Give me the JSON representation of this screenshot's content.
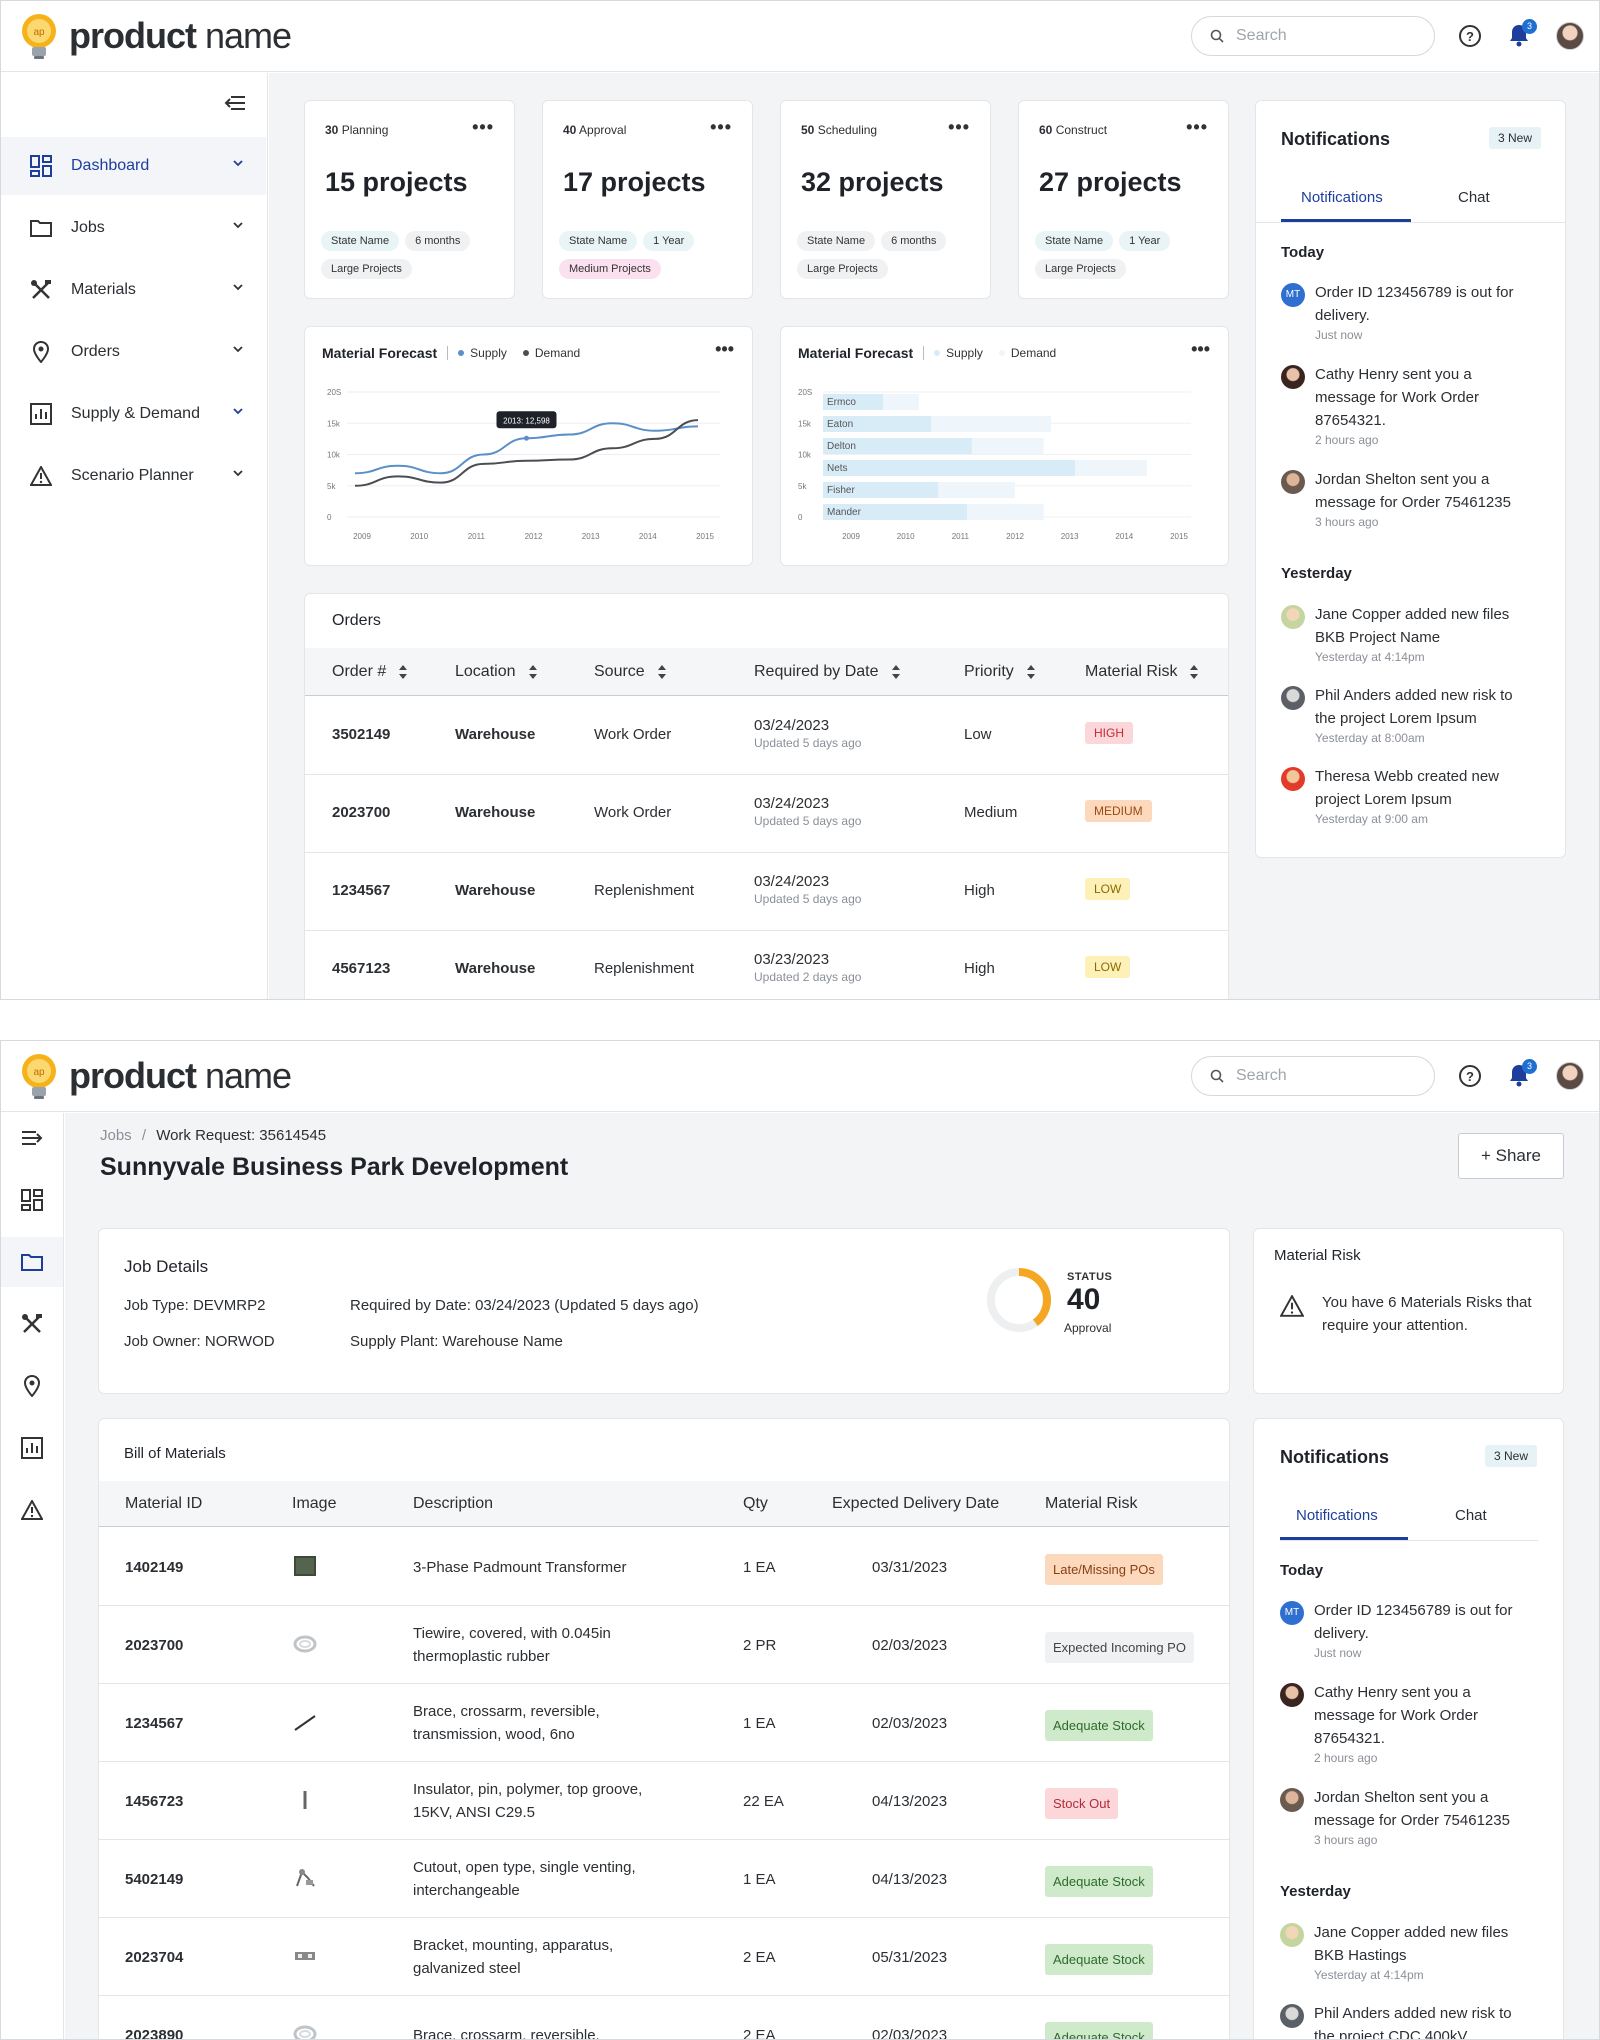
{
  "app": {
    "logo_bold": "product",
    "logo_rest": "name",
    "search_placeholder": "Search",
    "notification_count": "3"
  },
  "sidebar": {
    "items": [
      {
        "label": "Dashboard",
        "icon": "dashboard-icon"
      },
      {
        "label": "Jobs",
        "icon": "folder-icon"
      },
      {
        "label": "Materials",
        "icon": "tools-icon"
      },
      {
        "label": "Orders",
        "icon": "location-pin-icon"
      },
      {
        "label": "Supply & Demand",
        "icon": "bar-chart-icon"
      },
      {
        "label": "Scenario Planner",
        "icon": "warning-icon"
      }
    ]
  },
  "stats": [
    {
      "count": "30",
      "stage": "Planning",
      "projects": "15 projects",
      "tags": [
        "State Name",
        "6 months",
        "Large Projects"
      ]
    },
    {
      "count": "40",
      "stage": "Approval",
      "projects": "17 projects",
      "tags": [
        "State Name",
        "1 Year",
        "Medium Projects"
      ]
    },
    {
      "count": "50",
      "stage": "Scheduling",
      "projects": "32 projects",
      "tags": [
        "State Name",
        "6 months",
        "Large Projects"
      ]
    },
    {
      "count": "60",
      "stage": "Construct",
      "projects": "27 projects",
      "tags": [
        "State Name",
        "1 Year",
        "Large Projects"
      ]
    }
  ],
  "forecast_line": {
    "title": "Material Forecast",
    "legend_supply": "Supply",
    "legend_demand": "Demand",
    "tooltip": "2013: 12,598"
  },
  "forecast_bar": {
    "title": "Material Forecast",
    "legend_supply": "Supply",
    "legend_demand": "Demand"
  },
  "chart_data": [
    {
      "type": "line",
      "title": "Material Forecast",
      "x": [
        "2009",
        "2010",
        "2011",
        "2012",
        "2013",
        "2014",
        "2015"
      ],
      "ytick_labels": [
        "0",
        "5k",
        "10k",
        "15k",
        "20S"
      ],
      "ylim": [
        0,
        20000
      ],
      "series": [
        {
          "name": "Supply",
          "color": "#5b8fc7",
          "values": [
            7000,
            8200,
            7000,
            10000,
            12598,
            13200,
            15000,
            13800,
            14500
          ]
        },
        {
          "name": "Demand",
          "color": "#4a4d52",
          "values": [
            5000,
            6500,
            5500,
            8500,
            9000,
            9200,
            11000,
            12500,
            15500
          ]
        }
      ],
      "grid": true,
      "legend": "top"
    },
    {
      "type": "bar",
      "title": "Material Forecast",
      "x": [
        "2009",
        "2010",
        "2011",
        "2012",
        "2013",
        "2014",
        "2015"
      ],
      "ytick_labels": [
        "0",
        "5k",
        "10k",
        "15k",
        "20S"
      ],
      "categories": [
        "Ermco",
        "Eaton",
        "Delton",
        "Nets",
        "Fisher",
        "Mander"
      ],
      "series": [
        {
          "name": "Supply",
          "color": "#d7ecf7",
          "values": [
            2500,
            4500,
            6200,
            10500,
            4800,
            6000
          ]
        },
        {
          "name": "Demand",
          "color": "#eef6fb",
          "values": [
            4000,
            9500,
            9200,
            13500,
            8000,
            9200
          ]
        }
      ],
      "xlim": [
        0,
        14500
      ],
      "grid": true,
      "legend": "top"
    }
  ],
  "orders": {
    "title": "Orders",
    "columns": [
      "Order #",
      "Location",
      "Source",
      "Required by Date",
      "Priority",
      "Material Risk"
    ],
    "rows": [
      {
        "order": "3502149",
        "location": "Warehouse",
        "source": "Work Order",
        "date": "03/24/2023",
        "updated": "Updated 5 days ago",
        "priority": "Low",
        "risk": "HIGH",
        "risk_level": "high"
      },
      {
        "order": "2023700",
        "location": "Warehouse",
        "source": "Work Order",
        "date": "03/24/2023",
        "updated": "Updated 5 days ago",
        "priority": "Medium",
        "risk": "MEDIUM",
        "risk_level": "medium"
      },
      {
        "order": "1234567",
        "location": "Warehouse",
        "source": "Replenishment",
        "date": "03/24/2023",
        "updated": "Updated 5 days ago",
        "priority": "High",
        "risk": "LOW",
        "risk_level": "low"
      },
      {
        "order": "4567123",
        "location": "Warehouse",
        "source": "Replenishment",
        "date": "03/23/2023",
        "updated": "Updated 2 days ago",
        "priority": "High",
        "risk": "LOW",
        "risk_level": "low"
      }
    ]
  },
  "notifications": {
    "title": "Notifications",
    "new_badge": "3 New",
    "tab_notifications": "Notifications",
    "tab_chat": "Chat",
    "today": "Today",
    "yesterday": "Yesterday",
    "items_today": [
      {
        "avatar": "MT",
        "text": "Order ID 123456789 is out for delivery.",
        "time": "Just now"
      },
      {
        "avatar": "",
        "text": "Cathy Henry sent you a message for Work Order 87654321.",
        "time": "2 hours ago"
      },
      {
        "avatar": "",
        "text": "Jordan Shelton sent you a message for Order 75461235",
        "time": "3 hours ago"
      }
    ],
    "items_yesterday": [
      {
        "text": "Jane Copper added new files BKB Project Name",
        "time": "Yesterday at 4:14pm"
      },
      {
        "text": "Phil Anders added new risk to the project Lorem Ipsum",
        "time": "Yesterday at 8:00am"
      },
      {
        "text": "Theresa Webb created new project Lorem Ipsum",
        "time": "Yesterday at 9:00 am"
      }
    ]
  },
  "job": {
    "breadcrumb_root": "Jobs",
    "breadcrumb_sep": "/",
    "breadcrumb_current": "Work Request: 35614545",
    "title": "Sunnyvale Business Park Development",
    "share_label": "+ Share",
    "details_title": "Job Details",
    "job_type_label": "Job Type:",
    "job_type": "DEVMRP2",
    "job_owner_label": "Job Owner:",
    "job_owner": "NORWOD",
    "required_by": "Required by Date: 03/24/2023 (Updated 5 days ago)",
    "supply_plant": "Supply Plant: Warehouse Name",
    "status_label": "STATUS",
    "status_value": "40",
    "status_stage": "Approval",
    "status_progress": 0.4
  },
  "material_risk": {
    "title": "Material Risk",
    "text": "You have 6 Materials Risks that require your attention."
  },
  "bom": {
    "title": "Bill of Materials",
    "columns": [
      "Material ID",
      "Image",
      "Description",
      "Qty",
      "Expected Delivery Date",
      "Material Risk"
    ],
    "rows": [
      {
        "id": "1402149",
        "desc": "3-Phase Padmount Transformer",
        "qty": "1 EA",
        "date": "03/31/2023",
        "risk": "Late/Missing POs",
        "risk_level": "late",
        "img": "transformer-image"
      },
      {
        "id": "2023700",
        "desc": "Tiewire, covered, with 0.045in thermoplastic rubber",
        "qty": "2 PR",
        "date": "02/03/2023",
        "risk": "Expected Incoming PO",
        "risk_level": "exp",
        "img": "tiewire-image"
      },
      {
        "id": "1234567",
        "desc": "Brace, crossarm, reversible, transmission, wood, 6no",
        "qty": "1 EA",
        "date": "02/03/2023",
        "risk": "Adequate Stock",
        "risk_level": "ok",
        "img": "brace-image"
      },
      {
        "id": "1456723",
        "desc": "Insulator, pin, polymer, top groove, 15KV, ANSI C29.5",
        "qty": "22 EA",
        "date": "04/13/2023",
        "risk": "Stock Out",
        "risk_level": "out",
        "img": "insulator-image"
      },
      {
        "id": "5402149",
        "desc": "Cutout, open type, single venting, interchangeable",
        "qty": "1 EA",
        "date": "04/13/2023",
        "risk": "Adequate Stock",
        "risk_level": "ok",
        "img": "cutout-image"
      },
      {
        "id": "2023704",
        "desc": "Bracket, mounting, apparatus, galvanized steel",
        "qty": "2 EA",
        "date": "05/31/2023",
        "risk": "Adequate Stock",
        "risk_level": "ok",
        "img": "bracket-image"
      },
      {
        "id": "2023890",
        "desc": "Brace, crossarm, reversible,",
        "qty": "2 EA",
        "date": "02/03/2023",
        "risk": "Adequate Stock",
        "risk_level": "ok",
        "img": "tiewire-image"
      }
    ]
  },
  "notifications2": {
    "items_yesterday": [
      {
        "text": "Jane Copper added new files BKB Hastings",
        "time": "Yesterday at 4:14pm"
      },
      {
        "text": "Phil Anders added new risk to the project CDC 400kV",
        "time": ""
      }
    ]
  }
}
